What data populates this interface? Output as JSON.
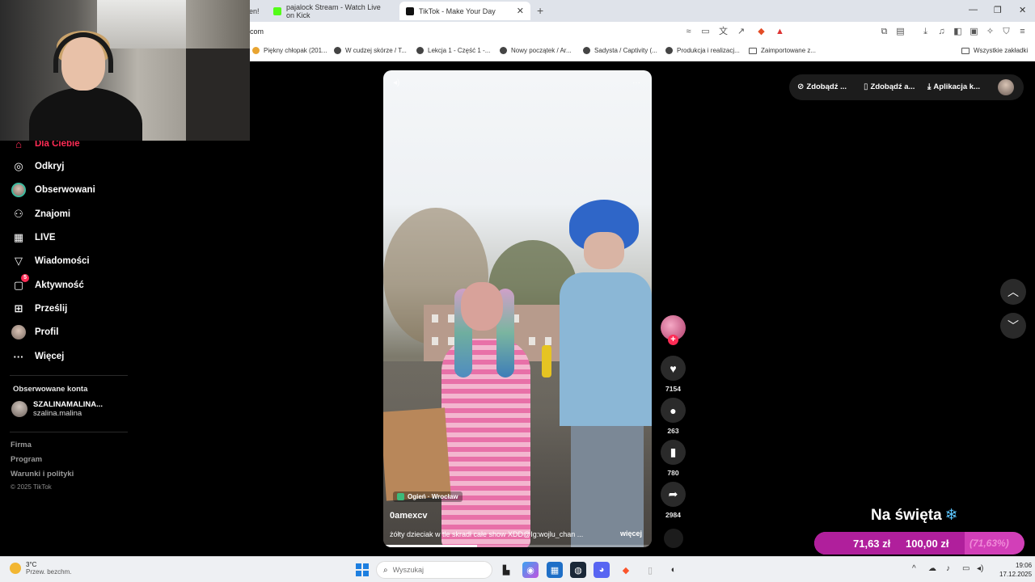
{
  "browser": {
    "tabs": [
      {
        "label": "en!",
        "active": false
      },
      {
        "label": "pajalock Stream - Watch Live on Kick",
        "active": false
      },
      {
        "label": "TikTok - Make Your Day",
        "active": true
      }
    ],
    "url": "com",
    "bookmarks": [
      "Piękny chłopak (201...",
      "W cudzej skórze / T...",
      "Lekcja 1 - Część 1 -...",
      "Nowy początek / Ar...",
      "Sadysta / Captivity (...",
      "Produkcja i realizacj...",
      "Zaimportowane z...",
      "Wszystkie zakładki"
    ]
  },
  "sidebar": {
    "items": [
      {
        "label": "Dla Ciebie",
        "icon": "home-icon"
      },
      {
        "label": "Odkryj",
        "icon": "compass-icon"
      },
      {
        "label": "Obserwowani",
        "icon": "avatar-icon"
      },
      {
        "label": "Znajomi",
        "icon": "friends-icon"
      },
      {
        "label": "LIVE",
        "icon": "live-icon"
      },
      {
        "label": "Wiadomości",
        "icon": "send-icon"
      },
      {
        "label": "Aktywność",
        "icon": "activity-icon",
        "badge": "5"
      },
      {
        "label": "Prześlij",
        "icon": "upload-icon"
      },
      {
        "label": "Profil",
        "icon": "profile-icon"
      },
      {
        "label": "Więcej",
        "icon": "more-icon"
      }
    ],
    "followed_title": "Obserwowane konta",
    "followed": {
      "name": "SZALINAMALINA...",
      "handle": "szalina.malina"
    },
    "footer_links": [
      "Firma",
      "Program",
      "Warunki i polityki"
    ],
    "copyright": "© 2025 TikTok"
  },
  "video": {
    "location": "Ogień · Wrocław",
    "author": "0amexcv",
    "caption": "żółty dzieciak w tle skradł całe show XDD@Ig:wojlu_chan ...",
    "more_label": "więcej",
    "progress": 0.35
  },
  "actions": {
    "likes": "7154",
    "comments": "263",
    "saves": "780",
    "shares": "2984"
  },
  "top_controls": {
    "coins_label": "Zdobądź ...",
    "app_label": "Zdobądź a...",
    "download_label": "Aplikacja k..."
  },
  "donation": {
    "title": "Na święta",
    "icon": "snowflake-icon",
    "current": "71,63 zł",
    "target": "100,00 zł",
    "percent": "(71,63%)",
    "fraction": 0.7163,
    "color": "#d23fb8"
  },
  "taskbar": {
    "weather_temp": "3°C",
    "weather_desc": "Przew. bezchm.",
    "search_placeholder": "Wyszukaj",
    "time": "19:06",
    "date": "17.12.2025"
  },
  "colors": {
    "accent": "#fe2c55",
    "background": "#000000"
  }
}
